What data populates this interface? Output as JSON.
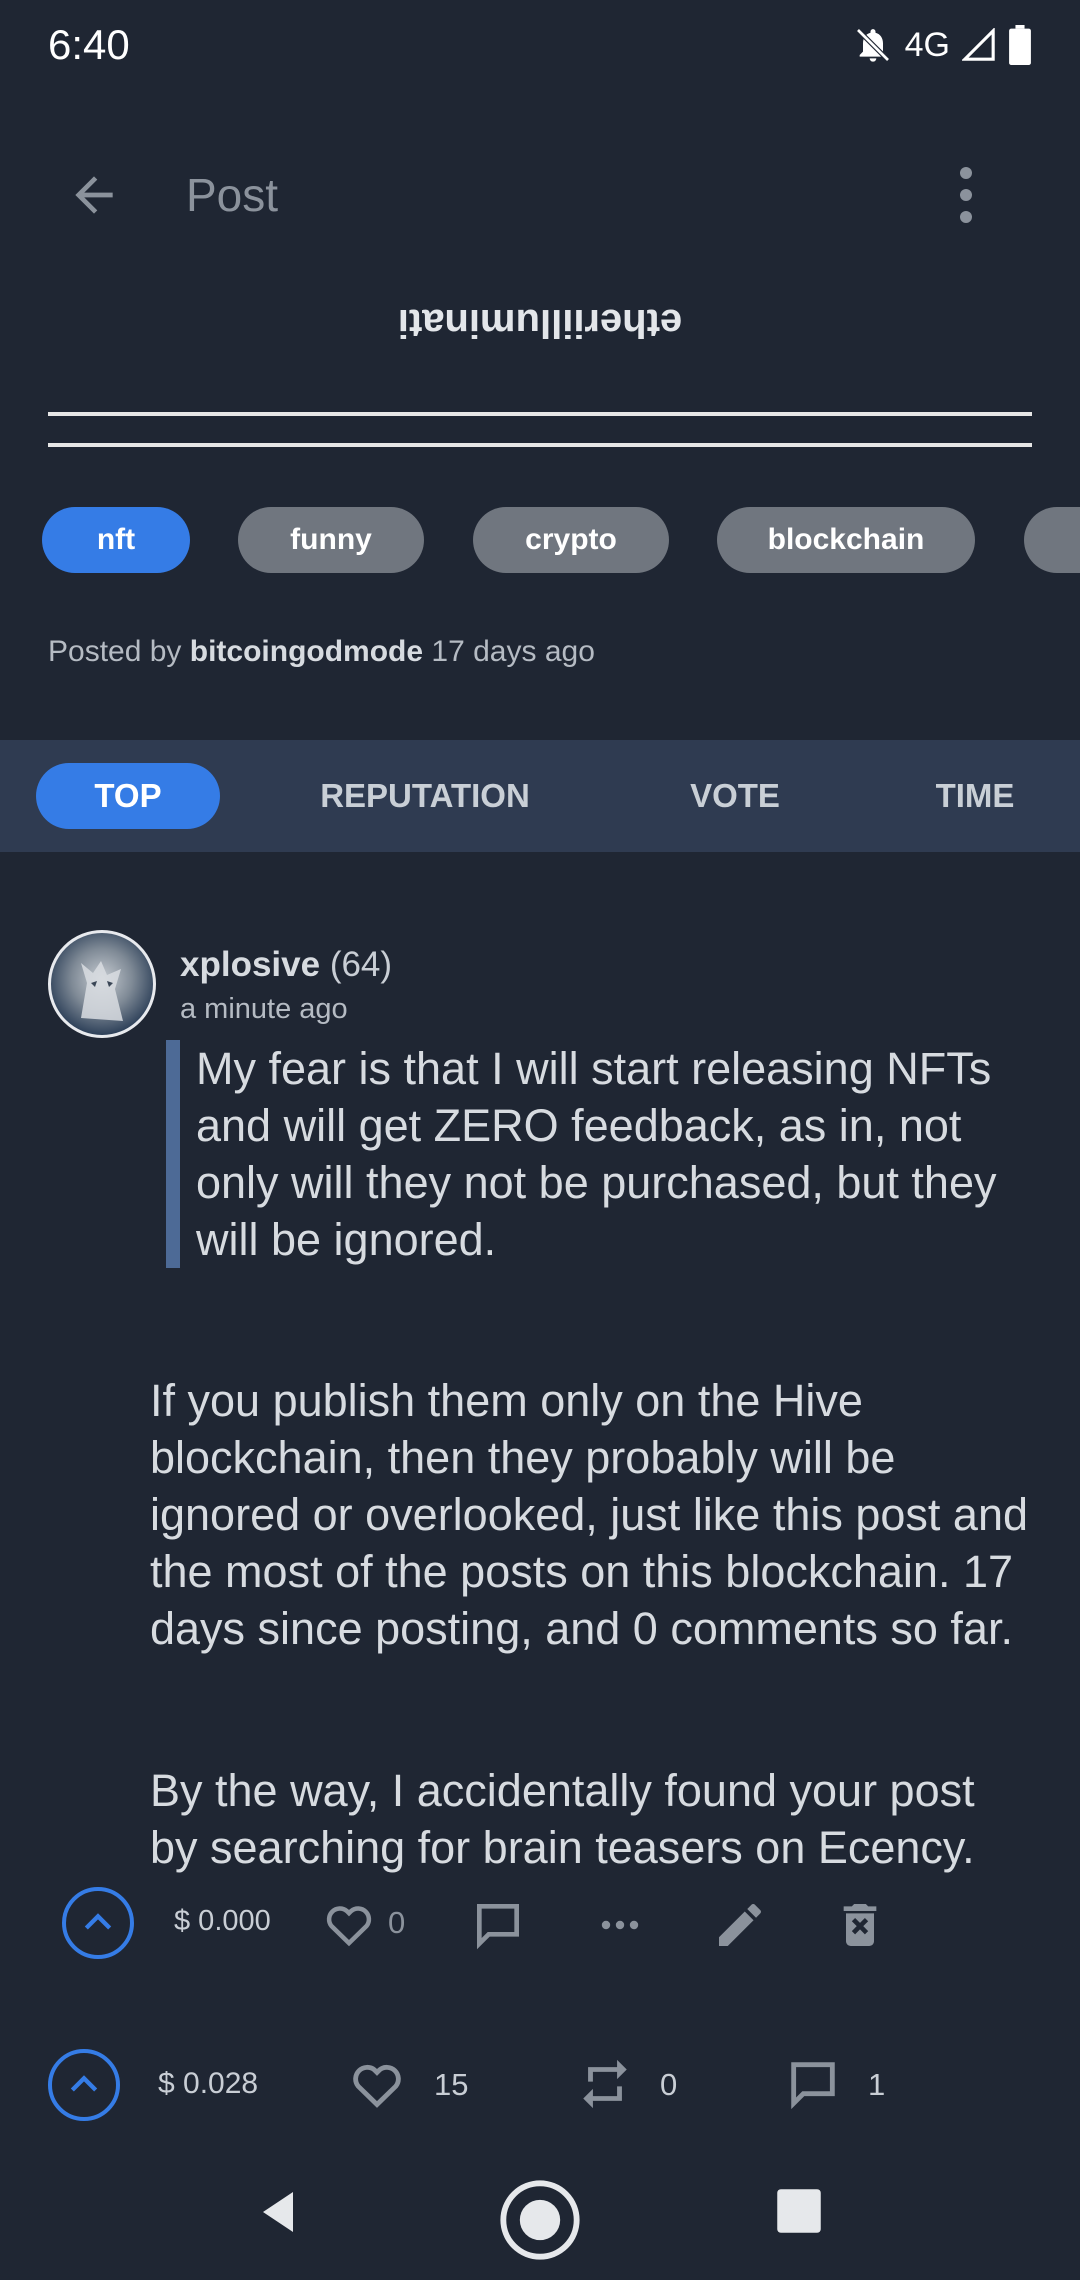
{
  "status": {
    "time": "6:40",
    "network": "4G"
  },
  "app_bar": {
    "title": "Post"
  },
  "post": {
    "title": "etheriilluminati",
    "tags": [
      "nft",
      "funny",
      "crypto",
      "blockchain"
    ],
    "posted_by_prefix": "Posted by",
    "author": "bitcoingodmode",
    "age": "17 days ago"
  },
  "sort_tabs": [
    "TOP",
    "REPUTATION",
    "VOTE",
    "TIME"
  ],
  "comment": {
    "author": "xplosive",
    "reputation": "(64)",
    "time": "a minute ago",
    "quote": "My fear is that I will start releasing NFTs and will get ZERO feedback, as in, not only will they not be purchased, but they will be ignored.",
    "paragraph1": "If you publish them only on the Hive blockchain, then they probably will be ignored or overlooked, just like this post and the most of the posts on this blockchain. 17 days since posting, and 0 comments so far.",
    "paragraph2": "By the way, I accidentally found your post by searching for brain teasers on Ecency.",
    "payout": "$ 0.000",
    "likes": "0"
  },
  "post_footer": {
    "payout": "$ 0.028",
    "likes": "15",
    "reblogs": "0",
    "comments": "1"
  },
  "colors": {
    "accent": "#357ce6",
    "background": "#1f2633",
    "tag": "#70767f",
    "sort_bar": "#2f3b51"
  }
}
